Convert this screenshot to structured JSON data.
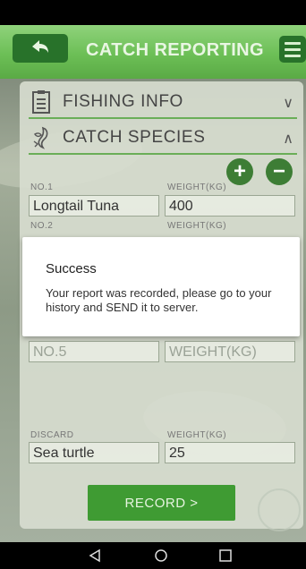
{
  "header": {
    "title": "CATCH REPORTING"
  },
  "sections": {
    "fishing_info": {
      "label": "FISHING INFO",
      "chevron": "∨"
    },
    "catch_species": {
      "label": "CATCH SPECIES",
      "chevron": "∧"
    }
  },
  "controls": {
    "add": "+",
    "remove": "−"
  },
  "species_rows": [
    {
      "no_label": "NO.1",
      "weight_label": "WEIGHT(KG)",
      "species": "Longtail Tuna",
      "weight": "400"
    },
    {
      "no_label": "NO.2",
      "weight_label": "WEIGHT(KG)"
    }
  ],
  "row5": {
    "no_placeholder": "NO.5",
    "weight_placeholder": "WEIGHT(KG)"
  },
  "discard": {
    "label": "DISCARD",
    "weight_label": "WEIGHT(KG)",
    "species": "Sea turtle",
    "weight": "25"
  },
  "record_button": "RECORD >",
  "dialog": {
    "title": "Success",
    "message": "Your report was recorded, please go to your history and SEND it to server."
  },
  "colors": {
    "header_green": "#6cbf56",
    "dark_green": "#28722a",
    "record_green": "#3f9b33"
  },
  "icons": [
    "back-arrow-icon",
    "menu-icon",
    "clipboard-icon",
    "fish-icon",
    "chevron-down-icon",
    "chevron-up-icon",
    "plus-icon",
    "minus-icon",
    "nav-back-icon",
    "nav-home-icon",
    "nav-recents-icon"
  ]
}
